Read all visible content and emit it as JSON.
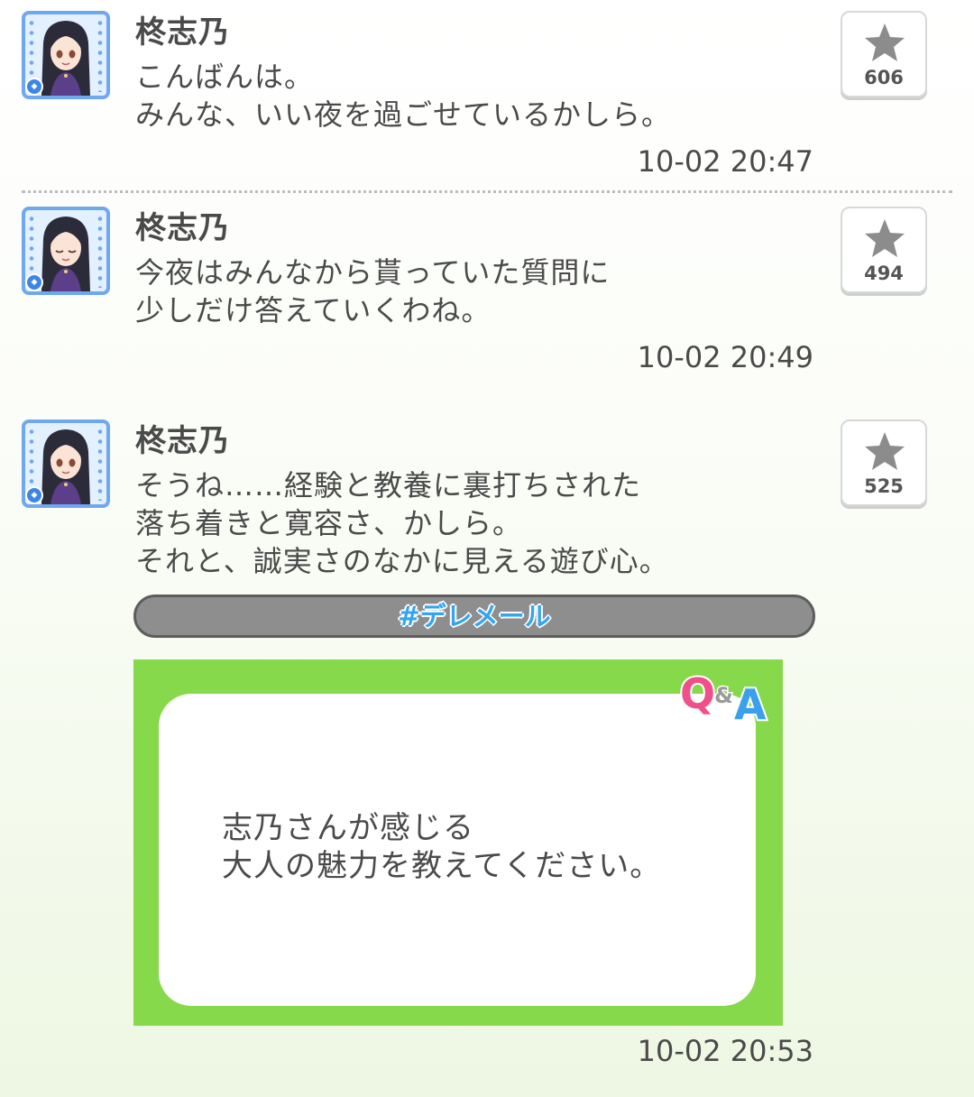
{
  "posts": [
    {
      "author": "柊志乃",
      "message": "こんばんは。\nみんな、いい夜を過ごせているかしら。",
      "likes": "606",
      "time": "10-02 20:47",
      "avatar_expression": "smile"
    },
    {
      "author": "柊志乃",
      "message": "今夜はみんなから貰っていた質問に\n少しだけ答えていくわね。",
      "likes": "494",
      "time": "10-02 20:49",
      "avatar_expression": "eyes-closed"
    },
    {
      "author": "柊志乃",
      "message": "そうね……経験と教養に裏打ちされた\n落ち着きと寛容さ、かしら。\nそれと、誠実さのなかに見える遊び心。",
      "likes": "525",
      "time": "10-02 20:53",
      "avatar_expression": "smile",
      "tag": "#デレメール",
      "qa_card": {
        "badge": "Q&A",
        "question": "志乃さんが感じる\n大人の魅力を教えてください。"
      }
    }
  ],
  "colors": {
    "avatar_border": "#6fa8ef",
    "tag_text": "#34a5ee",
    "qa_green": "#86d94a",
    "q_pink": "#f0508a",
    "a_blue": "#3aa0ee"
  },
  "icons": {
    "like": "star-icon",
    "avatar_badge": "diamond-icon"
  }
}
